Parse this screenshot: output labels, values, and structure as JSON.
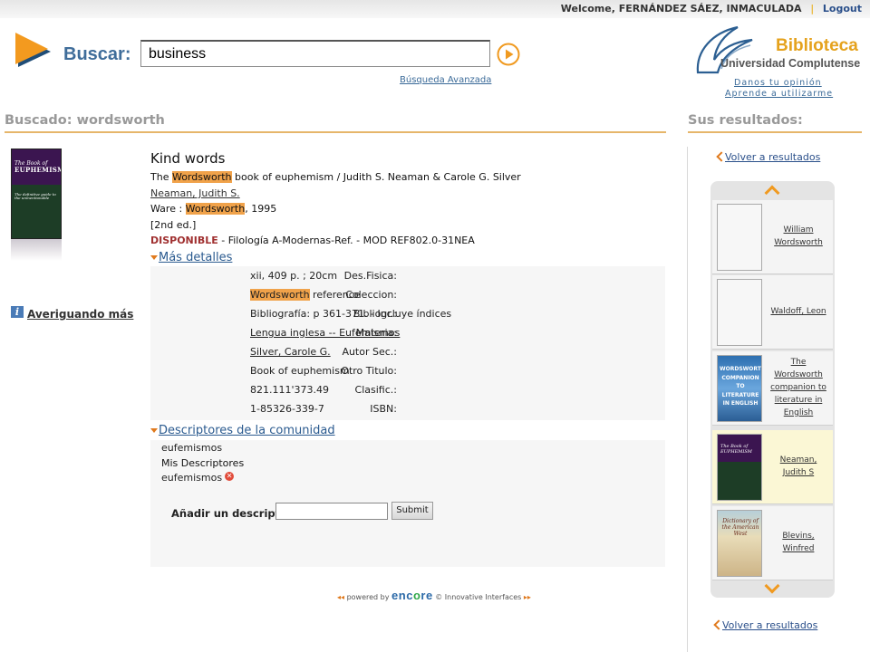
{
  "header": {
    "welcome_label": "Welcome,",
    "user_name": "FERNÁNDEZ SÁEZ, INMACULADA",
    "separator": "|",
    "logout_label": "Logout"
  },
  "search": {
    "label": "Buscar:",
    "value": "business",
    "advanced_link": "Búsqueda Avanzada"
  },
  "library": {
    "title": "Biblioteca",
    "subtitle": "Universidad Complutense",
    "links": [
      "Danos tu opinión",
      "Aprende a utilizarme"
    ]
  },
  "left": {
    "section_title": "Buscado: wordsworth",
    "cover_title": "The Book of",
    "cover_title_big": "EUPHEMISM",
    "cover_sub": "The definitive guide to the unmentionable",
    "info_icon": "i",
    "more_info_link": "Averiguando más"
  },
  "record": {
    "title": "Kind words",
    "line1_pre": "The ",
    "line1_hl": "Wordsworth",
    "line1_post": " book of euphemism / Judith S. Neaman & Carole G. Silver",
    "author_link": "Neaman, Judith S.",
    "pub_pre": "Ware : ",
    "pub_hl": "Wordsworth",
    "pub_post": ", 1995",
    "edition": "[2nd ed.]",
    "status": "DISPONIBLE",
    "location": "  -  Filología A-Modernas-Ref.  -  MOD REF802.0-31NEA"
  },
  "details": {
    "toggle_label": "Más detalles",
    "rows": [
      {
        "label": "Des.Fisica:",
        "value": "xii, 409 p. ; 20cm"
      },
      {
        "label": "Coleccion:",
        "hl": "Wordsworth",
        "value": " reference"
      },
      {
        "label": "Bibliogr.:",
        "value": "Bibliografía: p 361-371. - Incluye índices"
      },
      {
        "label": "Materia:",
        "link": "Lengua inglesa -- Eufemismos"
      },
      {
        "label": "Autor Sec.:",
        "link": "Silver, Carole G."
      },
      {
        "label": "Otro Titulo:",
        "value": "Book of euphemism"
      },
      {
        "label": "Clasific.:",
        "value": "821.111'373.49"
      },
      {
        "label": "ISBN:",
        "value": "1-85326-339-7"
      }
    ]
  },
  "community": {
    "toggle_label": "Descriptores de la comunidad",
    "tag": "eufemismos",
    "mine_label": "Mis Descriptores",
    "my_tag": "eufemismos",
    "delete_icon": "✕",
    "add_label": "Añadir un descriptor",
    "add_placeholder": "",
    "submit_label": "Submit"
  },
  "footer": {
    "arrows_left": "◂◂",
    "powered": "powered by",
    "encore_a": "enc",
    "encore_b": "o",
    "encore_c": "re",
    "company": "© Innovative Interfaces",
    "arrows_right": "▸▸"
  },
  "right": {
    "section_title": "Sus resultados:",
    "back_link": "Volver a resultados",
    "items": [
      {
        "label": "William Wordsworth"
      },
      {
        "label": "Waldoff, Leon"
      },
      {
        "label": "The Wordsworth companion to literature in English",
        "cover_text": "WORDSWORTH COMPANION TO LITERATURE IN ENGLISH"
      },
      {
        "label": "Neaman, Judith S",
        "cover_text": "The Book of EUPHEMISM"
      },
      {
        "label": "Blevins, Winfred",
        "cover_text": "Dictionary of the American West"
      }
    ]
  },
  "colors": {
    "accent_orange": "#f0a24a",
    "link_blue": "#2a4f8a",
    "heading_gray": "#999999",
    "status_red": "#a03030"
  }
}
